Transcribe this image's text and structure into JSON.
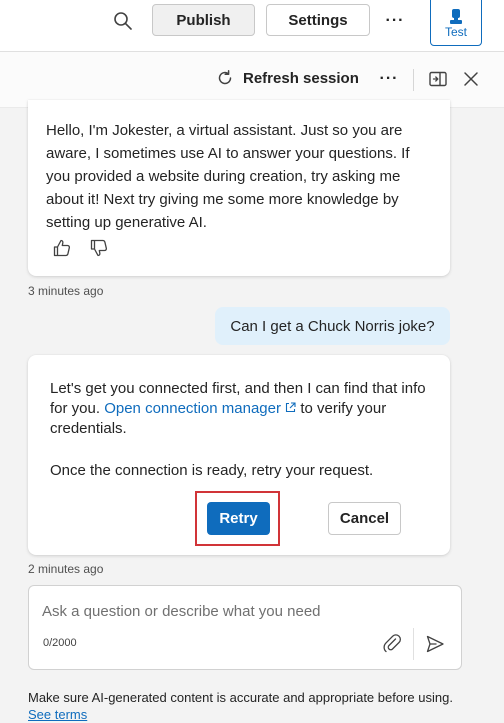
{
  "header": {
    "publish_label": "Publish",
    "settings_label": "Settings",
    "more_label": "···",
    "test_label": "Test"
  },
  "subheader": {
    "refresh_label": "Refresh session",
    "more_label": "···"
  },
  "messages": {
    "bot_greeting": "Hello, I'm Jokester, a virtual assistant. Just so you are aware, I sometimes use AI to answer your questions. If you provided a website during creation, try asking me about it! Next try giving me some more knowledge by setting up generative AI.",
    "greeting_time": "3 minutes ago",
    "user_message": "Can I get a Chuck Norris joke?",
    "bot_reply_pre": "Let's get you connected first, and then I can find that info for you. ",
    "bot_reply_link": "Open connection manager",
    "bot_reply_post": " to verify your credentials.",
    "bot_reply_p2": "Once the connection is ready, retry your request.",
    "retry_label": "Retry",
    "cancel_label": "Cancel",
    "reply_time": "2 minutes ago"
  },
  "composer": {
    "placeholder": "Ask a question or describe what you need",
    "value": "",
    "counter": "0/2000"
  },
  "footer": {
    "disclaimer": "Make sure AI-generated content is accurate and appropriate before using. ",
    "terms_link": "See terms"
  },
  "colors": {
    "accent": "#0f6cbd",
    "user_bubble": "#e0f0fb",
    "highlight": "#d13438"
  },
  "icons": {
    "search": "search-icon",
    "test": "chess-pawn-icon",
    "refresh": "refresh-icon",
    "panel": "panel-icon",
    "close": "close-icon",
    "thumbs_up": "thumbs-up-icon",
    "thumbs_down": "thumbs-down-icon",
    "external_link": "external-link-icon",
    "attach": "paperclip-icon",
    "send": "send-icon"
  }
}
